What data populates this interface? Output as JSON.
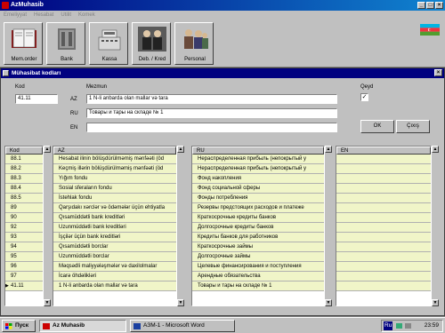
{
  "app": {
    "title": "AzMuhasib"
  },
  "menu": [
    "Emeliyyat",
    "Hesabat",
    "Utilit",
    "Komek"
  ],
  "toolbar": [
    {
      "label": "Mem.order",
      "icon": "book-icon"
    },
    {
      "label": "Bank",
      "icon": "bank-icon"
    },
    {
      "label": "Kassa",
      "icon": "cash-register-icon"
    },
    {
      "label": "Deb. / Kred",
      "icon": "people-icon"
    },
    {
      "label": "Personal",
      "icon": "personnel-icon"
    }
  ],
  "dialog": {
    "title": "Mühasibat kodları",
    "kod_label": "Kod",
    "kod_value": "41.11",
    "mezmun_label": "Mezmun",
    "az_label": "AZ",
    "az_value": "1 N-li anbarda olan mallar və tara",
    "ru_label": "RU",
    "ru_value": "Товары и тары на складе № 1",
    "en_label": "EN",
    "en_value": "",
    "qeyd_label": "Qeyd",
    "qeyd_checked": true,
    "ok_label": "OK",
    "cancel_label": "Çıxış"
  },
  "table": {
    "headers": {
      "kod": "Kod",
      "az": "AZ",
      "ru": "RU",
      "en": "EN"
    },
    "rows": [
      {
        "kod": "88.1",
        "az": "Hesabat ilinin bölüşdürülməmiş mənfəəti (öd",
        "ru": "Нераспределенная прибыль (непокрытый у"
      },
      {
        "kod": "88.2",
        "az": "Keçmiş illərin bölüşdürülməmiş mənfəəti (öd",
        "ru": "Нераспределенная прибыль (непокрытый у"
      },
      {
        "kod": "88.3",
        "az": "Yığım fondu",
        "ru": "Фонд накопления"
      },
      {
        "kod": "88.4",
        "az": "Sosial sferaların fondu",
        "ru": "Фонд социальной сферы"
      },
      {
        "kod": "88.5",
        "az": "İstehlak fondu",
        "ru": "Фонды потребления"
      },
      {
        "kod": "89",
        "az": "Qarşıdakı xərclər və ödəmələr üçün ehtiyatla",
        "ru": "Резервы предстоящих расходов и платеже"
      },
      {
        "kod": "90",
        "az": "Qısamüddətli bank kreditləri",
        "ru": "Краткосрочные  кредиты банков"
      },
      {
        "kod": "92",
        "az": "Uzunmüddətli bank kreditləri",
        "ru": "Долгосрочные  кредиты банков"
      },
      {
        "kod": "93",
        "az": "İşçilər üçün bank kreditləri",
        "ru": "Кредиты банков для работников"
      },
      {
        "kod": "94",
        "az": "Qısamüddətli borclar",
        "ru": "Краткосрочные займы"
      },
      {
        "kod": "95",
        "az": "Uzunmüddətli borclar",
        "ru": "Долгосрочные займы"
      },
      {
        "kod": "96",
        "az": "Məqsədli maliyyələşmələr  və daxilolmalar",
        "ru": "Целевые финансирования и поступления"
      },
      {
        "kod": "97",
        "az": "İcarə öhdəlikləri",
        "ru": "Арендные обязательства"
      },
      {
        "kod": "41.11",
        "az": "1 N-li anbarda olan mallar və tara",
        "ru": "Товары и тары на складе № 1",
        "current": true
      }
    ]
  },
  "taskbar": {
    "start_label": "Пуск",
    "tasks": [
      {
        "label": "Az Muhasib",
        "active": true
      },
      {
        "label": "АЗМ-1 - Microsoft Word",
        "active": false
      }
    ],
    "lang": "Ru",
    "time": "23:59"
  },
  "colors": {
    "title_active": "#000080",
    "row_bg": "#f0f5c8",
    "face": "#c0c0c0"
  }
}
